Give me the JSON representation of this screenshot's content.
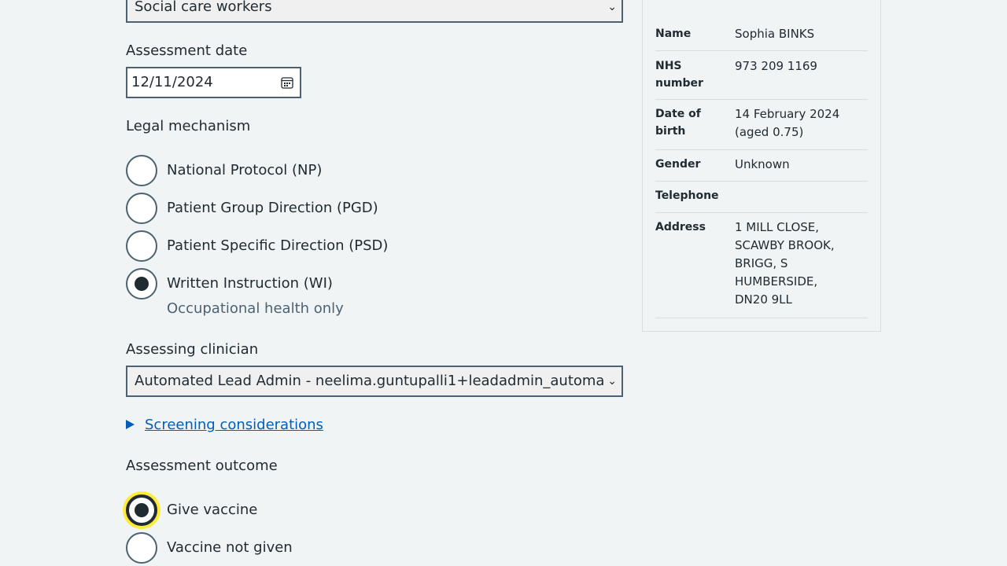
{
  "form": {
    "staff_type_select": {
      "value": "Social care workers"
    },
    "assessment_date": {
      "label": "Assessment date",
      "value": "12/11/2024"
    },
    "legal_mechanism": {
      "legend": "Legal mechanism",
      "options": [
        {
          "label": "National Protocol (NP)",
          "checked": false
        },
        {
          "label": "Patient Group Direction (PGD)",
          "checked": false
        },
        {
          "label": "Patient Specific Direction (PSD)",
          "checked": false
        },
        {
          "label": "Written Instruction (WI)",
          "checked": true,
          "hint": "Occupational health only"
        }
      ]
    },
    "assessing_clinician": {
      "label": "Assessing clinician",
      "value": "Automated Lead Admin - neelima.guntupalli1+leadadmin_automa"
    },
    "screening_considerations": {
      "label": "Screening considerations"
    },
    "assessment_outcome": {
      "legend": "Assessment outcome",
      "options": [
        {
          "label": "Give vaccine",
          "checked": true,
          "focused": true
        },
        {
          "label": "Vaccine not given",
          "checked": false
        }
      ]
    }
  },
  "patient_summary": {
    "rows": [
      {
        "key": "Name",
        "value": "Sophia BINKS"
      },
      {
        "key": "NHS number",
        "value": "973 209 1169"
      },
      {
        "key": "Date of birth",
        "value": "14 February 2024 (aged 0.75)"
      },
      {
        "key": "Gender",
        "value": "Unknown"
      },
      {
        "key": "Telephone",
        "value": ""
      },
      {
        "key": "Address",
        "value": "1 MILL CLOSE, SCAWBY BROOK, BRIGG, S HUMBERSIDE, DN20 9LL"
      }
    ]
  },
  "colors": {
    "background": "#f0f4f5",
    "text": "#212b32",
    "link": "#005eb8",
    "border": "#4c6272",
    "focus": "#ffeb3b"
  }
}
